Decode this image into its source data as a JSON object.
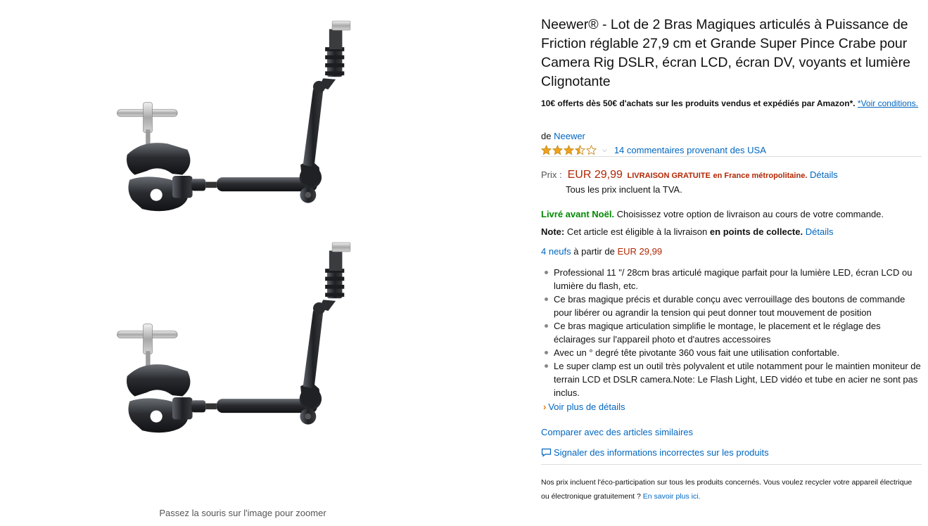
{
  "image_col": {
    "zoom_hint": "Passez la souris sur l'image pour zoomer"
  },
  "product": {
    "title": "Neewer® - Lot de 2 Bras Magiques articulés à Puissance de Friction réglable 27,9 cm et Grande Super Pince Crabe pour Camera Rig DSLR, écran LCD, écran DV, voyants et lumière Clignotante",
    "promo_text": "10€ offerts dès 50€ d'achats sur les produits vendus et expédiés par Amazon*.",
    "promo_link": "*Voir conditions.",
    "brand_prefix": "de",
    "brand": "Neewer",
    "rating": 3.5,
    "rating_max": 5,
    "reviews_link": "14 commentaires provenant des USA",
    "price_label": "Prix :",
    "price": "EUR 29,99",
    "free_shipping": "Livraison gratuite",
    "free_shipping_rest": "en France métropolitaine.",
    "details_link": "Détails",
    "tva": "Tous les prix incluent la TVA.",
    "delivery_strong": "Livré avant Noël.",
    "delivery_rest": "Choisissez votre option de livraison au cours de votre commande.",
    "note_label": "Note:",
    "note_text": "Cet article est éligible à la livraison",
    "note_strong": "en points de collecte.",
    "note_link": "Détails",
    "offers_link": "4 neufs",
    "offers_mid": "à partir de",
    "offers_price": "EUR 29,99",
    "bullets": [
      "Professional 11 \"/ 28cm bras articulé magique parfait pour la lumière LED, écran LCD ou lumière du flash, etc.",
      "Ce bras magique précis et durable conçu avec verrouillage des boutons de commande pour libérer ou agrandir la tension qui peut donner tout mouvement de position",
      "Ce bras magique articulation simplifie le montage, le placement et le réglage des éclairages sur l'appareil photo et d'autres accessoires",
      "Avec un ° degré tête pivotante 360 vous fait une utilisation confortable.",
      "Le super clamp est un outil très polyvalent et utile notamment pour le maintien moniteur de terrain LCD et DSLR camera.Note: Le Flash Light, LED vidéo et tube en acier ne sont pas inclus."
    ],
    "more_details": "Voir plus de détails",
    "compare": "Comparer avec des articles similaires",
    "report": "Signaler des informations incorrectes sur les produits",
    "eco_text": "Nos prix incluent l'éco-participation sur tous les produits concernés. Vous voulez recycler votre appareil électrique ou électronique gratuitement ?",
    "eco_link": "En savoir plus ici."
  },
  "colors": {
    "link": "#0066c0",
    "price": "#b12704",
    "green": "#008a00",
    "star": "#f0a31a"
  },
  "icons": [
    "star-icon",
    "chevron-down-icon",
    "chevron-right-icon",
    "comment-icon"
  ]
}
